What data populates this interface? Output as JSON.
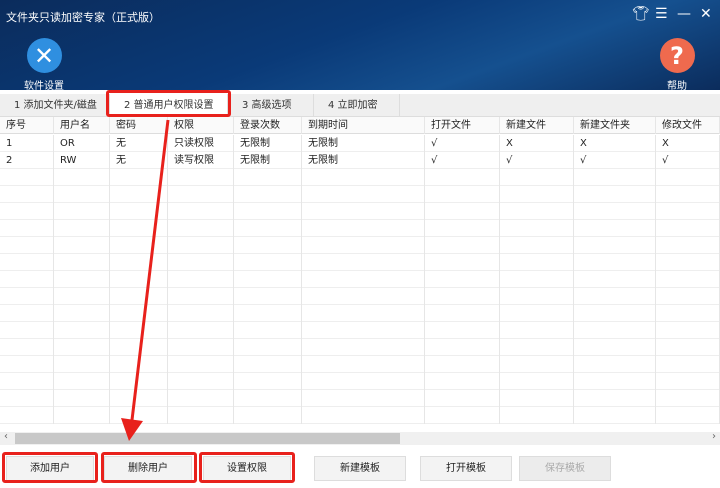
{
  "window": {
    "title": "文件夹只读加密专家（正式版）"
  },
  "toolbar": {
    "settings_label": "软件设置",
    "help_label": "帮助",
    "help_glyph": "?"
  },
  "tabs": [
    {
      "label": "1 添加文件夹/磁盘"
    },
    {
      "label": "2 普通用户权限设置"
    },
    {
      "label": "3 高级选项"
    },
    {
      "label": "4 立即加密"
    }
  ],
  "table": {
    "headers": [
      "序号",
      "用户名",
      "密码",
      "权限",
      "登录次数",
      "到期时间",
      "打开文件",
      "新建文件",
      "新建文件夹",
      "修改文件"
    ],
    "rows": [
      [
        "1",
        "OR",
        "无",
        "只读权限",
        "无限制",
        "无限制",
        "√",
        "X",
        "X",
        "X"
      ],
      [
        "2",
        "RW",
        "无",
        "读写权限",
        "无限制",
        "无限制",
        "√",
        "√",
        "√",
        "√"
      ]
    ]
  },
  "buttons": {
    "add_user": "添加用户",
    "delete_user": "删除用户",
    "set_permission": "设置权限",
    "new_template": "新建模板",
    "open_template": "打开模板",
    "save_template": "保存模板"
  },
  "colors": {
    "highlight": "#e8211c",
    "settings": "#2f8fe0",
    "help": "#ef6a4e"
  }
}
